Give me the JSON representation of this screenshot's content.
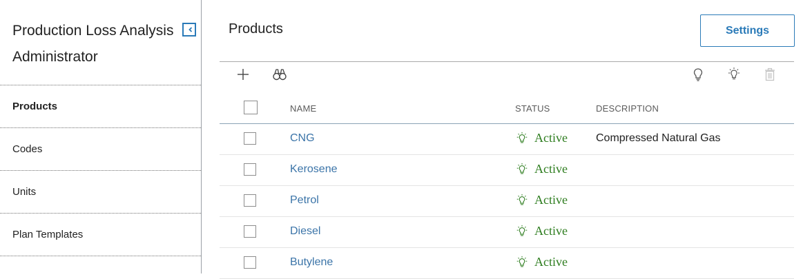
{
  "sidebar": {
    "title_line1": "Production Loss Analysis",
    "title_line2": "Administrator",
    "items": [
      {
        "label": "Products",
        "active": true
      },
      {
        "label": "Codes",
        "active": false
      },
      {
        "label": "Units",
        "active": false
      },
      {
        "label": "Plan Templates",
        "active": false
      }
    ]
  },
  "main": {
    "title": "Products",
    "settings_label": "Settings",
    "toolbar": {
      "icons": [
        "plus-icon",
        "binoculars-icon",
        "lightbulb-icon",
        "lightbulb-on-icon",
        "trash-icon"
      ]
    },
    "table": {
      "headers": {
        "name": "NAME",
        "status": "STATUS",
        "description": "DESCRIPTION"
      },
      "rows": [
        {
          "name": "CNG",
          "status": "Active",
          "description": "Compressed Natural Gas"
        },
        {
          "name": "Kerosene",
          "status": "Active",
          "description": ""
        },
        {
          "name": "Petrol",
          "status": "Active",
          "description": ""
        },
        {
          "name": "Diesel",
          "status": "Active",
          "description": ""
        },
        {
          "name": "Butylene",
          "status": "Active",
          "description": ""
        }
      ]
    }
  },
  "colors": {
    "accent": "#2a7ab8",
    "link": "#3b74a8",
    "active_status": "#2e7d1f"
  }
}
